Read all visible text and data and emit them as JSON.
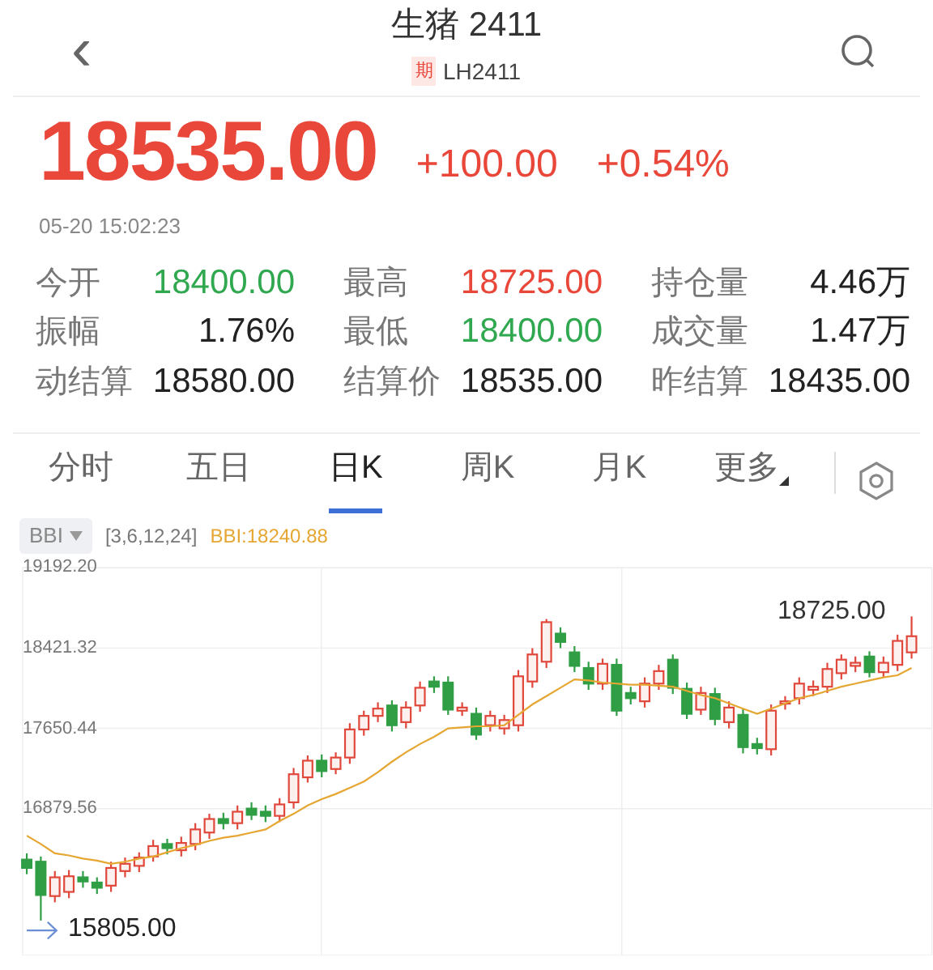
{
  "header": {
    "back": "‹",
    "title": "生猪 2411",
    "badge": "期",
    "code": "LH2411"
  },
  "quote": {
    "price": "18535.00",
    "change": "+100.00",
    "change_pct": "+0.54%",
    "time": "05-20 15:02:23"
  },
  "stats": [
    {
      "label": "今开",
      "value": "18400.00",
      "color": "#2fa84f"
    },
    {
      "label": "最高",
      "value": "18725.00",
      "color": "#e8473a"
    },
    {
      "label": "持仓量",
      "value": "4.46万",
      "color": "#222222"
    },
    {
      "label": "振幅",
      "value": "1.76%",
      "color": "#222222"
    },
    {
      "label": "最低",
      "value": "18400.00",
      "color": "#2fa84f"
    },
    {
      "label": "成交量",
      "value": "1.47万",
      "color": "#222222"
    },
    {
      "label": "动结算",
      "value": "18580.00",
      "color": "#222222"
    },
    {
      "label": "结算价",
      "value": "18535.00",
      "color": "#222222"
    },
    {
      "label": "昨结算",
      "value": "18435.00",
      "color": "#222222"
    }
  ],
  "tabs": [
    {
      "label": "分时",
      "selected": false
    },
    {
      "label": "五日",
      "selected": false
    },
    {
      "label": "日K",
      "selected": true
    },
    {
      "label": "周K",
      "selected": false
    },
    {
      "label": "月K",
      "selected": false
    },
    {
      "label": "更多",
      "selected": false
    }
  ],
  "indicator": {
    "params": "[3,6,12,24]",
    "value": "BBI:18240.88"
  },
  "chart": {
    "high_label": "18725.00",
    "low_label": "15805.00",
    "chart_data": {
      "type": "candlestick",
      "categories": [
        null,
        null,
        null,
        null,
        null,
        null,
        null,
        null,
        null,
        null,
        null,
        null,
        null,
        null,
        null,
        null,
        null,
        null,
        null,
        null,
        null,
        null,
        null,
        null,
        null,
        null,
        null,
        null,
        null,
        null,
        null,
        null,
        null,
        null,
        null,
        null,
        null,
        null,
        null,
        null,
        null,
        null,
        null,
        null,
        null,
        null,
        null,
        null,
        null,
        null,
        null,
        null,
        null,
        null,
        null,
        null,
        null,
        null,
        null,
        null,
        null,
        null,
        null,
        null
      ],
      "ohlc": [
        [
          16390,
          16450,
          16250,
          16310
        ],
        [
          16370,
          16420,
          15805,
          16050
        ],
        [
          16040,
          16280,
          15980,
          16220
        ],
        [
          16080,
          16290,
          16020,
          16230
        ],
        [
          16220,
          16280,
          16120,
          16180
        ],
        [
          16170,
          16220,
          16060,
          16120
        ],
        [
          16140,
          16370,
          16080,
          16310
        ],
        [
          16280,
          16410,
          16220,
          16350
        ],
        [
          16330,
          16460,
          16270,
          16410
        ],
        [
          16420,
          16580,
          16370,
          16520
        ],
        [
          16540,
          16590,
          16440,
          16500
        ],
        [
          16480,
          16610,
          16420,
          16550
        ],
        [
          16540,
          16740,
          16480,
          16680
        ],
        [
          16650,
          16830,
          16590,
          16780
        ],
        [
          16780,
          16840,
          16680,
          16740
        ],
        [
          16740,
          16910,
          16680,
          16850
        ],
        [
          16880,
          16940,
          16770,
          16820
        ],
        [
          16850,
          16910,
          16750,
          16810
        ],
        [
          16810,
          16980,
          16750,
          16920
        ],
        [
          16940,
          17270,
          16880,
          17210
        ],
        [
          17180,
          17390,
          17130,
          17340
        ],
        [
          17340,
          17400,
          17180,
          17240
        ],
        [
          17260,
          17420,
          17210,
          17370
        ],
        [
          17370,
          17700,
          17310,
          17640
        ],
        [
          17640,
          17820,
          17580,
          17770
        ],
        [
          17770,
          17900,
          17710,
          17840
        ],
        [
          17870,
          17920,
          17620,
          17680
        ],
        [
          17710,
          17910,
          17650,
          17850
        ],
        [
          17870,
          18100,
          17810,
          18040
        ],
        [
          18100,
          18150,
          17990,
          18050
        ],
        [
          18090,
          18150,
          17780,
          17830
        ],
        [
          17820,
          17900,
          17770,
          17850
        ],
        [
          17790,
          17850,
          17540,
          17590
        ],
        [
          17680,
          17820,
          17620,
          17770
        ],
        [
          17650,
          17780,
          17590,
          17730
        ],
        [
          17680,
          18210,
          17620,
          18150
        ],
        [
          18100,
          18420,
          18040,
          18360
        ],
        [
          18290,
          18700,
          18230,
          18670
        ],
        [
          18560,
          18620,
          18420,
          18480
        ],
        [
          18380,
          18440,
          18190,
          18250
        ],
        [
          18230,
          18290,
          18020,
          18080
        ],
        [
          18080,
          18320,
          18020,
          18270
        ],
        [
          18260,
          18320,
          17770,
          17820
        ],
        [
          17990,
          18050,
          17880,
          17940
        ],
        [
          17910,
          18140,
          17850,
          18080
        ],
        [
          18080,
          18260,
          18020,
          18200
        ],
        [
          18310,
          18360,
          17980,
          18040
        ],
        [
          18030,
          18090,
          17740,
          17790
        ],
        [
          17830,
          18050,
          17780,
          17990
        ],
        [
          17980,
          18040,
          17680,
          17740
        ],
        [
          17710,
          17910,
          17650,
          17850
        ],
        [
          17780,
          17840,
          17410,
          17470
        ],
        [
          17500,
          17560,
          17400,
          17460
        ],
        [
          17450,
          17880,
          17390,
          17820
        ],
        [
          17890,
          17960,
          17830,
          17910
        ],
        [
          17940,
          18140,
          17880,
          18080
        ],
        [
          18020,
          18110,
          17960,
          18050
        ],
        [
          18050,
          18280,
          17990,
          18220
        ],
        [
          18180,
          18360,
          18120,
          18310
        ],
        [
          18250,
          18340,
          18190,
          18280
        ],
        [
          18340,
          18390,
          18140,
          18190
        ],
        [
          18190,
          18340,
          18140,
          18280
        ],
        [
          18260,
          18550,
          18200,
          18490
        ],
        [
          18380,
          18725,
          18320,
          18535
        ]
      ],
      "ylim": [
        15470,
        19192.2
      ],
      "grid": true,
      "yticks": [
        {
          "value": 19192.2,
          "label": "19192.20"
        },
        {
          "value": 18421.32,
          "label": "18421.32"
        },
        {
          "value": 17650.44,
          "label": "17650.44"
        },
        {
          "value": 16879.56,
          "label": "16879.56"
        }
      ]
    },
    "indicator_chart": {
      "chart_data": {
        "type": "line",
        "categories": [
          null,
          null,
          null,
          null,
          null,
          null,
          null,
          null,
          null,
          null,
          null,
          null,
          null,
          null,
          null,
          null,
          null,
          null,
          null,
          null,
          null,
          null,
          null,
          null,
          null,
          null,
          null,
          null,
          null,
          null,
          null,
          null,
          null,
          null,
          null,
          null,
          null,
          null,
          null,
          null,
          null,
          null,
          null,
          null,
          null,
          null,
          null,
          null,
          null,
          null,
          null,
          null,
          null,
          null,
          null,
          null,
          null,
          null,
          null,
          null,
          null,
          null,
          null,
          null
        ],
        "series": [
          {
            "name": "BBI",
            "color": "#e5a632",
            "values": [
              16620,
              16540,
              16450,
              16430,
              16400,
              16380,
              16350,
              16370,
              16400,
              16420,
              16460,
              16500,
              16530,
              16570,
              16600,
              16620,
              16650,
              16680,
              16760,
              16830,
              16910,
              16970,
              17020,
              17080,
              17140,
              17230,
              17330,
              17420,
              17500,
              17570,
              17650,
              17660,
              17670,
              17670,
              17680,
              17780,
              17880,
              17960,
              18040,
              18120,
              18110,
              18090,
              18080,
              18070,
              18070,
              18060,
              18050,
              18010,
              17970,
              17940,
              17890,
              17840,
              17790,
              17840,
              17890,
              17940,
              17970,
              18010,
              18050,
              18080,
              18110,
              18140,
              18160,
              18230
            ]
          }
        ],
        "ylim": [
          15470,
          19192.2
        ]
      }
    }
  }
}
